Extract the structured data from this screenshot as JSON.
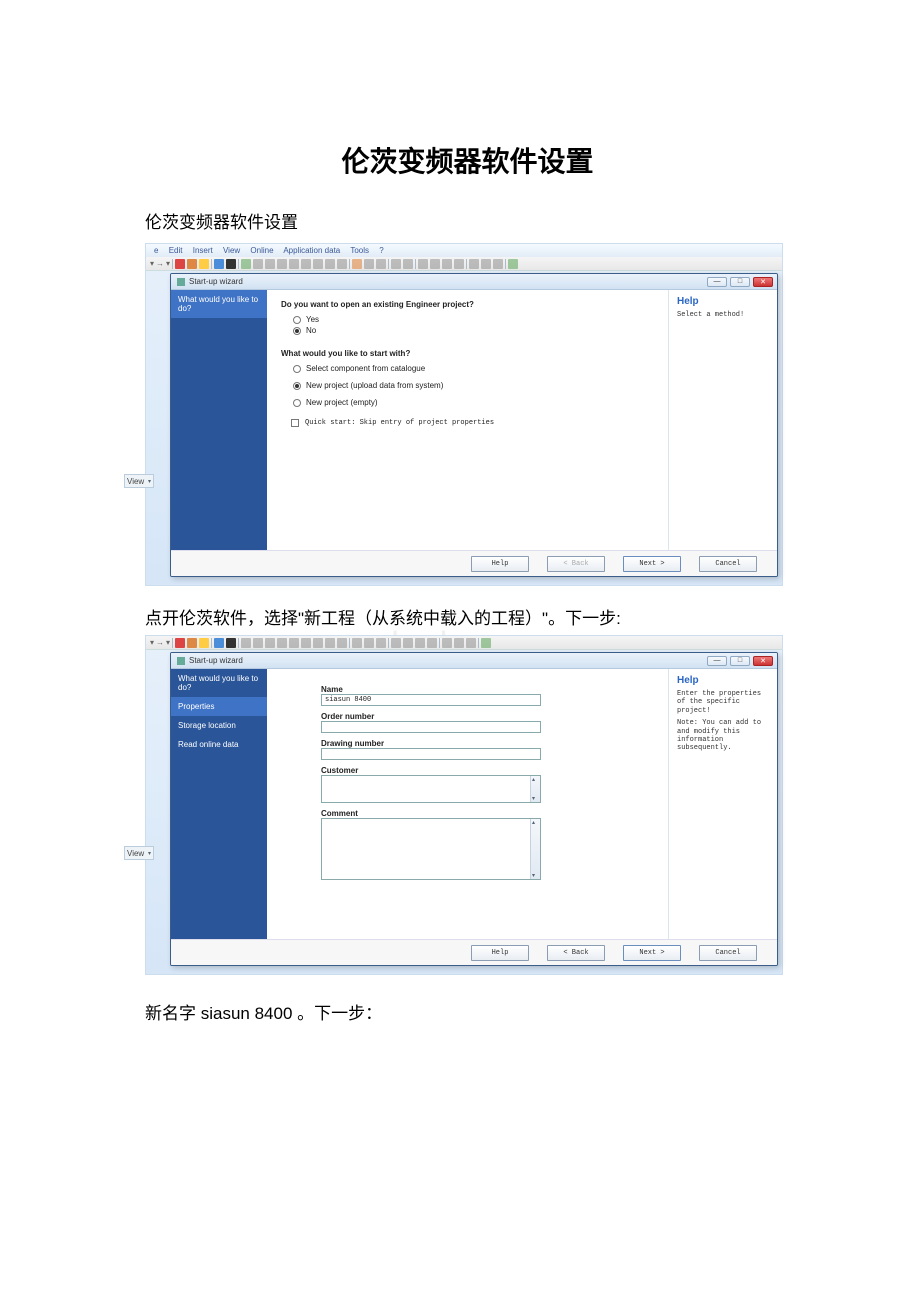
{
  "doc": {
    "title": "伦茨变频器软件设置",
    "subtitle": "伦茨变频器软件设置",
    "paragraph1": "点开伦茨软件，选择\"新工程（从系统中载入的工程）\"。下一步:",
    "paragraph2": "新名字 siasun 8400 。下一步："
  },
  "menubar": [
    "e",
    "Edit",
    "Insert",
    "View",
    "Online",
    "Application data",
    "Tools",
    "?"
  ],
  "view_label": "View",
  "dialog1": {
    "title": "Start-up wizard",
    "sidebar": [
      "What would you like to do?"
    ],
    "q1": "Do you want to open an existing Engineer project?",
    "yes": "Yes",
    "no": "No",
    "q2": "What would you like to start with?",
    "opt1": "Select component from catalogue",
    "opt2": "New project (upload data from system)",
    "opt3": "New project (empty)",
    "quickstart": "Quick start: Skip entry of project properties",
    "help_title": "Help",
    "help_text": "Select a method!",
    "btn_help": "Help",
    "btn_back": "< Back",
    "btn_next": "Next >",
    "btn_cancel": "Cancel"
  },
  "dialog2": {
    "title": "Start-up wizard",
    "sidebar": [
      "What would you like to do?",
      "Properties",
      "Storage location",
      "Read online data"
    ],
    "lbl_name": "Name",
    "val_name": "siasun 8400",
    "lbl_order": "Order number",
    "lbl_drawing": "Drawing number",
    "lbl_customer": "Customer",
    "lbl_comment": "Comment",
    "help_title": "Help",
    "help_text1": "Enter the properties of the specific project!",
    "help_text2": "Note: You can add to and modify this information subsequently.",
    "btn_help": "Help",
    "btn_back": "< Back",
    "btn_next": "Next >",
    "btn_cancel": "Cancel"
  }
}
